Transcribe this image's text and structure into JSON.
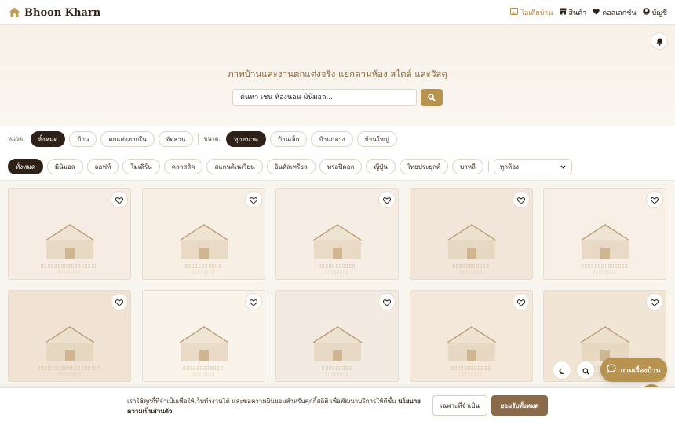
{
  "header": {
    "logo_text": "Bhoon Kharn",
    "nav": [
      {
        "label": "ไอเดียบ้าน",
        "icon": "image-icon",
        "active": true
      },
      {
        "label": "สินค้า",
        "icon": "store-icon",
        "active": false
      },
      {
        "label": "คอลเลกชัน",
        "icon": "heart-icon",
        "active": false
      },
      {
        "label": "บัญชี",
        "icon": "user-icon",
        "active": false
      }
    ]
  },
  "hero": {
    "title": "ภาพบ้านและงานตกแต่งจริง แยกตามห้อง สไตล์ และวัสดุ",
    "search_placeholder": "ค้นหา เช่น ห้องนอน มินิมอล..."
  },
  "filters": {
    "category_label": "หมวด:",
    "categories": [
      "ทั้งหมด",
      "บ้าน",
      "ตกแต่งภายใน",
      "จัดสวน"
    ],
    "size_label": "ขนาด:",
    "sizes": [
      "ทุกขนาด",
      "บ้านเล็ก",
      "บ้านกลาง",
      "บ้านใหญ่"
    ],
    "styles": [
      "ทั้งหมด",
      "มินิมอล",
      "ลอฟท์",
      "โมเดิร์น",
      "คลาสสิค",
      "สแกนดิเนเวียน",
      "อินดัสเทรียล",
      "ทรอปิคอล",
      "ญี่ปุ่น",
      "ไทยประยุกต์",
      "บาหลี"
    ],
    "room_select": "ทุกห้อง"
  },
  "grid": {
    "cards": [
      {
        "bg": "#f6ece3",
        "ph1": "▯▯▯▯▯▯▯▯▯▯▯▯▯▯▯▯▯",
        "ph2": "▯▯▯▯▯▯▯▯"
      },
      {
        "bg": "#f7efe4",
        "ph1": "▯▯▯▯▯▯▯▯▯▯▯",
        "ph2": "▯▯▯▯▯▯▯▯"
      },
      {
        "bg": "#f6ede4",
        "ph1": "▯▯▯▯▯▯▯▯▯▯▯",
        "ph2": "▯▯▯▯▯▯▯▯"
      },
      {
        "bg": "#f1e6d9",
        "ph1": "▯▯▯▯▯▯▯▯▯▯▯",
        "ph2": "▯▯▯▯▯▯▯▯"
      },
      {
        "bg": "#f8f0e6",
        "ph1": "▯▯▯▯▯▯▯▯▯▯▯▯▯▯",
        "ph2": "▯▯▯▯▯▯▯▯"
      },
      {
        "bg": "#f0e3d3",
        "ph1": "▯▯▯▯▯▯▯▯▯▯▯▯▯▯▯▯▯▯▯",
        "ph2": "▯▯▯▯▯▯▯▯"
      },
      {
        "bg": "#f9f3e9",
        "ph1": "▯▯▯▯▯▯▯▯▯▯▯▯",
        "ph2": "▯▯▯▯▯▯▯▯"
      },
      {
        "bg": "#f3ebe1",
        "ph1": "▯▯▯▯▯▯▯▯▯",
        "ph2": "▯▯▯▯▯▯▯▯"
      },
      {
        "bg": "#f4e8db",
        "ph1": "▯▯▯▯▯▯▯▯▯▯▯▯",
        "ph2": "▯▯▯▯▯▯▯▯"
      },
      {
        "bg": "#f1e5d6",
        "ph1": "▯▯▯▯▯▯▯▯▯▯▯▯▯▯▯",
        "ph2": "▯▯▯▯▯▯▯▯"
      }
    ]
  },
  "floating": {
    "chat_label": "ถามเรื่องบ้าน"
  },
  "cookie": {
    "text": "เราใช้คุกกี้ที่จำเป็นเพื่อให้เว็บทำงานได้ และขอความยินยอมสำหรับคุกกี้สถิติ เพื่อพัฒนาบริการให้ดีขึ้น ",
    "link": "นโยบายความเป็นส่วนตัว",
    "btn_essential": "เฉพาะที่จำเป็น",
    "btn_accept": "ยอมรับทั้งหมด"
  },
  "colors": {
    "accent": "#b8924f",
    "dark": "#2e2218",
    "accept": "#8a6a48"
  }
}
